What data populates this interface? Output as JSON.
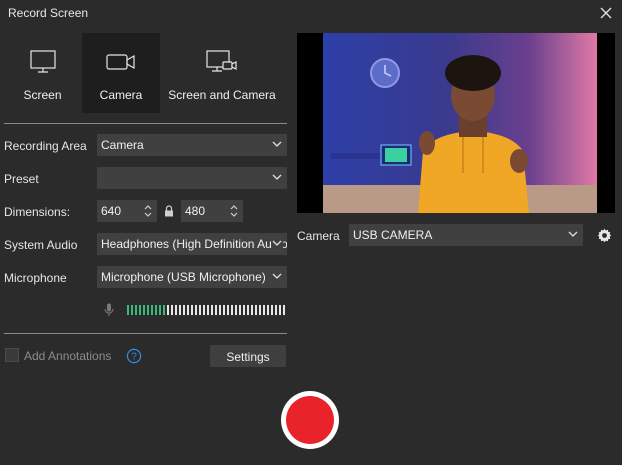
{
  "window": {
    "title": "Record Screen"
  },
  "modes": [
    {
      "label": "Screen",
      "icon": "monitor-icon",
      "selected": false
    },
    {
      "label": "Camera",
      "icon": "video-camera-icon",
      "selected": true
    },
    {
      "label": "Screen and Camera",
      "icon": "monitor-camera-icon",
      "selected": false
    }
  ],
  "settings": {
    "recording_area": {
      "label": "Recording Area",
      "value": "Camera"
    },
    "preset": {
      "label": "Preset",
      "value": ""
    },
    "dimensions": {
      "label": "Dimensions:",
      "width": "640",
      "height": "480"
    },
    "system_audio": {
      "label": "System Audio",
      "value": "Headphones (High Definition Audio Device)"
    },
    "microphone": {
      "label": "Microphone",
      "value": "Microphone (USB Microphone)",
      "level": 0.25
    }
  },
  "annotations": {
    "label": "Add Annotations",
    "checked": false
  },
  "settings_button": {
    "label": "Settings"
  },
  "camera": {
    "label": "Camera",
    "value": "USB CAMERA"
  },
  "colors": {
    "accent": "#2f8fe0",
    "record": "#e8232a",
    "meter_active": "#3cb878",
    "meter_idle": "#e8e8e8"
  },
  "icons": {
    "close": "close-icon",
    "lock": "lock-icon",
    "mic": "microphone-icon",
    "help": "help-circle-icon",
    "gear": "gear-icon",
    "record": "record-icon"
  }
}
